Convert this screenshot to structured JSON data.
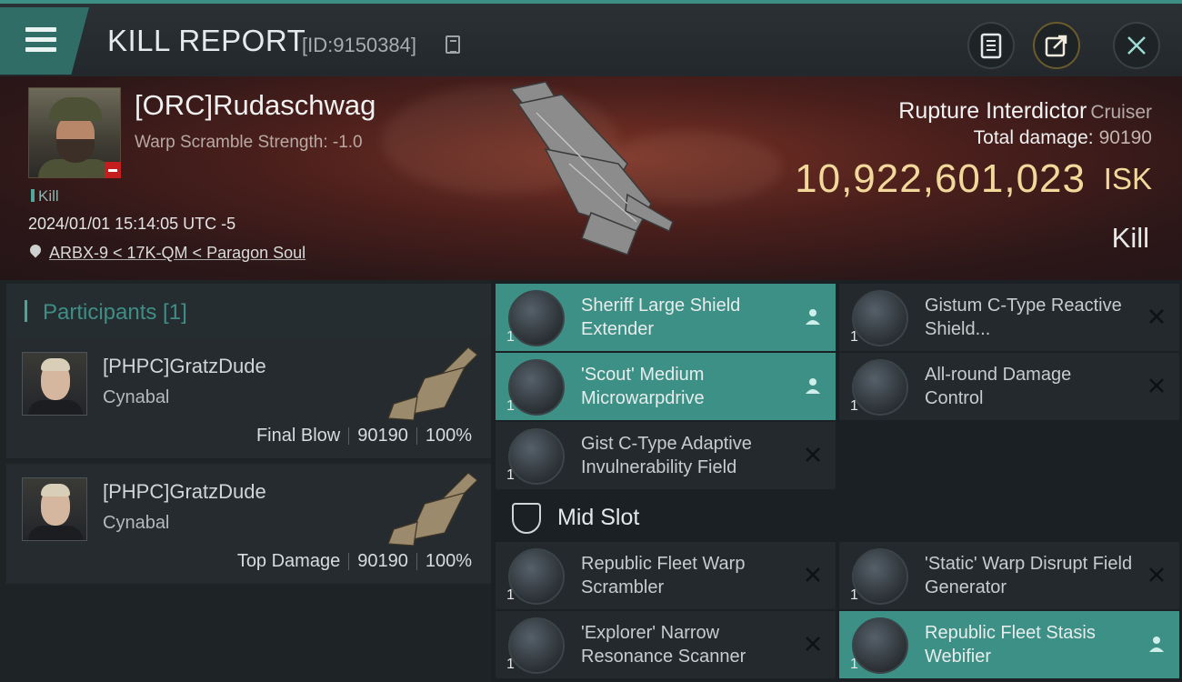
{
  "header": {
    "title": "KILL REPORT",
    "report_id": "[ID:9150384]",
    "icons": [
      "menu-icon",
      "copy-icon",
      "clipboard-icon",
      "share-icon",
      "close-icon"
    ]
  },
  "victim": {
    "name": "[ORC]Rudaschwag",
    "warp_strength": "Warp Scramble Strength: -1.0",
    "tag": "Kill",
    "datetime": "2024/01/01 15:14:05 UTC -5",
    "location": "ARBX-9 < 17K-QM < Paragon Soul",
    "ship_name": "Rupture Interdictor",
    "ship_class": "Cruiser",
    "total_damage_label": "Total damage:",
    "total_damage": "90190",
    "isk_value": "10,922,601,023",
    "isk_unit": "ISK",
    "result": "Kill"
  },
  "participants": {
    "title": "Participants [1]",
    "items": [
      {
        "name": "[PHPC]GratzDude",
        "ship": "Cynabal",
        "role": "Final Blow",
        "damage": "90190",
        "percent": "100%"
      },
      {
        "name": "[PHPC]GratzDude",
        "ship": "Cynabal",
        "role": "Top Damage",
        "damage": "90190",
        "percent": "100%"
      }
    ]
  },
  "slots": {
    "mid_slot_label": "Mid Slot",
    "low": [
      {
        "name": "Sheriff Large Shield Extender",
        "qty": "1",
        "state": "dropped"
      },
      {
        "name": "Gistum C-Type Reactive Shield...",
        "qty": "1",
        "state": "destroyed"
      },
      {
        "name": "'Scout' Medium Microwarpdrive",
        "qty": "1",
        "state": "dropped"
      },
      {
        "name": "All-round Damage Control",
        "qty": "1",
        "state": "destroyed"
      },
      {
        "name": "Gist C-Type Adaptive Invulnerability Field",
        "qty": "1",
        "state": "destroyed"
      }
    ],
    "mid": [
      {
        "name": "Republic Fleet Warp Scrambler",
        "qty": "1",
        "state": "destroyed"
      },
      {
        "name": "'Static' Warp Disrupt Field Generator",
        "qty": "1",
        "state": "destroyed"
      },
      {
        "name": "'Explorer' Narrow Resonance Scanner",
        "qty": "1",
        "state": "destroyed"
      },
      {
        "name": "Republic Fleet Stasis Webifier",
        "qty": "1",
        "state": "dropped"
      }
    ]
  },
  "colors": {
    "accent": "#3d9085",
    "isk": "#f2d99b",
    "loss_badge": "#c41e1e"
  }
}
